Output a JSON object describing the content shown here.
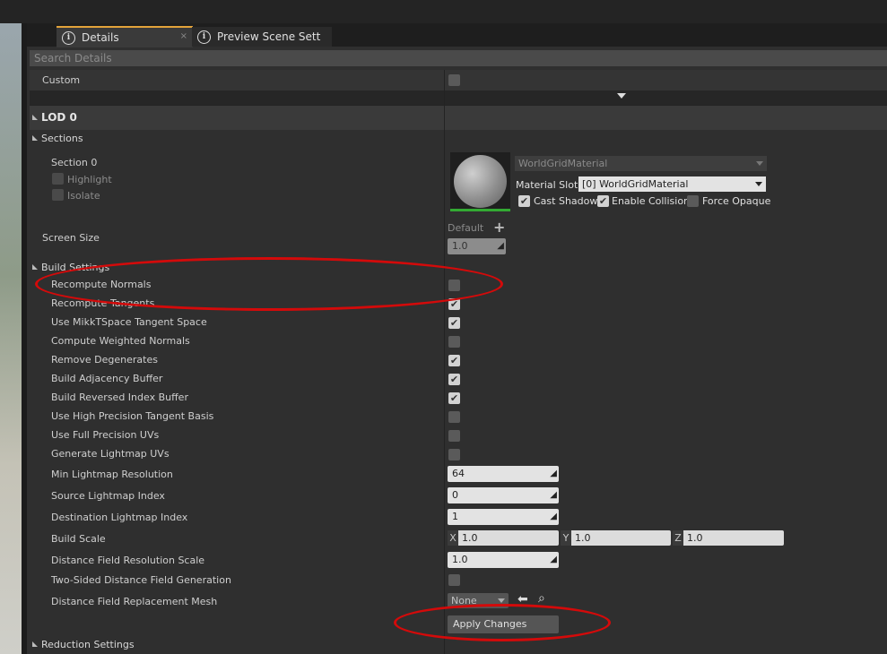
{
  "tabs": [
    {
      "label": "Details"
    },
    {
      "label": "Preview Scene Sett"
    }
  ],
  "search": {
    "placeholder": "Search Details"
  },
  "custom": {
    "label": "Custom"
  },
  "lod": {
    "title": "LOD 0"
  },
  "sections": {
    "header": "Sections",
    "section0": "Section 0",
    "highlight": "Highlight",
    "isolate": "Isolate",
    "material_name": "WorldGridMaterial",
    "material_slot_label": "Material Slot",
    "material_slot_value": "[0] WorldGridMaterial",
    "cast_shadow": "Cast Shadow",
    "enable_collision": "Enable Collision",
    "force_opaque": "Force Opaque"
  },
  "screen_size": {
    "label": "Screen Size",
    "default_label": "Default",
    "plus": "+",
    "value": "1.0"
  },
  "build_settings": {
    "header": "Build Settings",
    "rows": [
      {
        "label": "Recompute Normals",
        "checked": false
      },
      {
        "label": "Recompute Tangents",
        "checked": true
      },
      {
        "label": "Use MikkTSpace Tangent Space",
        "checked": true
      },
      {
        "label": "Compute Weighted Normals",
        "checked": false
      },
      {
        "label": "Remove Degenerates",
        "checked": true
      },
      {
        "label": "Build Adjacency Buffer",
        "checked": true
      },
      {
        "label": "Build Reversed Index Buffer",
        "checked": true
      },
      {
        "label": "Use High Precision Tangent Basis",
        "checked": false
      },
      {
        "label": "Use Full Precision UVs",
        "checked": false
      },
      {
        "label": "Generate Lightmap UVs",
        "checked": false
      }
    ],
    "min_lightmap_res": {
      "label": "Min Lightmap Resolution",
      "value": "64"
    },
    "source_lightmap_index": {
      "label": "Source Lightmap Index",
      "value": "0"
    },
    "dest_lightmap_index": {
      "label": "Destination Lightmap Index",
      "value": "1"
    },
    "build_scale": {
      "label": "Build Scale",
      "x": "1.0",
      "y": "1.0",
      "z": "1.0",
      "x_axis": "X",
      "y_axis": "Y",
      "z_axis": "Z"
    },
    "df_res_scale": {
      "label": "Distance Field Resolution Scale",
      "value": "1.0"
    },
    "two_sided_df": {
      "label": "Two-Sided Distance Field Generation"
    },
    "df_replacement": {
      "label": "Distance Field Replacement Mesh",
      "value": "None"
    },
    "apply_changes": "Apply Changes"
  },
  "reduction_settings": {
    "header": "Reduction Settings"
  },
  "colors": {
    "annotation": "#d40a0a",
    "tab_accent": "#e3a33a"
  }
}
